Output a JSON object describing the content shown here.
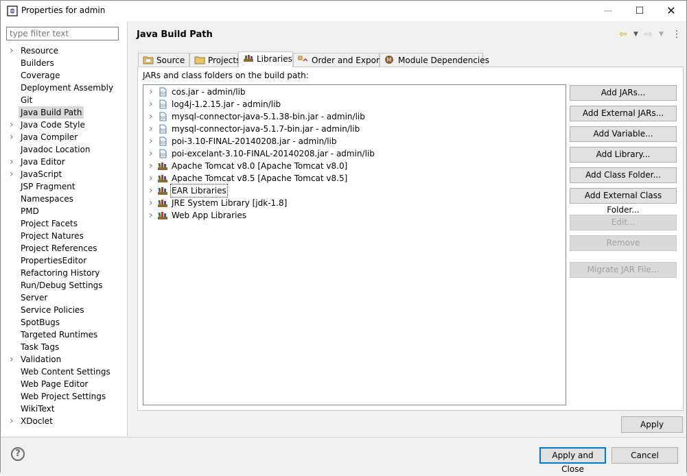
{
  "window": {
    "title": "Properties for admin",
    "minimize": "—",
    "maximize": "☐",
    "close": "✕"
  },
  "filter": {
    "placeholder": "type filter text",
    "value": ""
  },
  "nav": [
    {
      "label": "Resource",
      "expandable": true
    },
    {
      "label": "Builders",
      "expandable": false
    },
    {
      "label": "Coverage",
      "expandable": false
    },
    {
      "label": "Deployment Assembly",
      "expandable": false
    },
    {
      "label": "Git",
      "expandable": false
    },
    {
      "label": "Java Build Path",
      "expandable": false,
      "selected": true
    },
    {
      "label": "Java Code Style",
      "expandable": true
    },
    {
      "label": "Java Compiler",
      "expandable": true
    },
    {
      "label": "Javadoc Location",
      "expandable": false
    },
    {
      "label": "Java Editor",
      "expandable": true
    },
    {
      "label": "JavaScript",
      "expandable": true
    },
    {
      "label": "JSP Fragment",
      "expandable": false
    },
    {
      "label": "Namespaces",
      "expandable": false
    },
    {
      "label": "PMD",
      "expandable": false
    },
    {
      "label": "Project Facets",
      "expandable": false
    },
    {
      "label": "Project Natures",
      "expandable": false
    },
    {
      "label": "Project References",
      "expandable": false
    },
    {
      "label": "PropertiesEditor",
      "expandable": false
    },
    {
      "label": "Refactoring History",
      "expandable": false
    },
    {
      "label": "Run/Debug Settings",
      "expandable": false
    },
    {
      "label": "Server",
      "expandable": false
    },
    {
      "label": "Service Policies",
      "expandable": false
    },
    {
      "label": "SpotBugs",
      "expandable": false
    },
    {
      "label": "Targeted Runtimes",
      "expandable": false
    },
    {
      "label": "Task Tags",
      "expandable": false
    },
    {
      "label": "Validation",
      "expandable": true
    },
    {
      "label": "Web Content Settings",
      "expandable": false
    },
    {
      "label": "Web Page Editor",
      "expandable": false
    },
    {
      "label": "Web Project Settings",
      "expandable": false
    },
    {
      "label": "WikiText",
      "expandable": false
    },
    {
      "label": "XDoclet",
      "expandable": true
    }
  ],
  "page": {
    "title": "Java Build Path",
    "tabs": [
      {
        "label": "Source",
        "icon": "source-folder-icon"
      },
      {
        "label": "Projects",
        "icon": "projects-folder-icon"
      },
      {
        "label": "Libraries",
        "icon": "libraries-icon",
        "active": true
      },
      {
        "label": "Order and Export",
        "icon": "order-export-icon"
      },
      {
        "label": "Module Dependencies",
        "icon": "module-icon"
      }
    ],
    "libraries_label": "JARs and class folders on the build path:",
    "entries": [
      {
        "label": "cos.jar - admin/lib",
        "kind": "jar"
      },
      {
        "label": "log4j-1.2.15.jar - admin/lib",
        "kind": "jar"
      },
      {
        "label": "mysql-connector-java-5.1.38-bin.jar - admin/lib",
        "kind": "jar"
      },
      {
        "label": "mysql-connector-java-5.1.7-bin.jar - admin/lib",
        "kind": "jar"
      },
      {
        "label": "poi-3.10-FINAL-20140208.jar - admin/lib",
        "kind": "jar"
      },
      {
        "label": "poi-excelant-3.10-FINAL-20140208.jar - admin/lib",
        "kind": "jar"
      },
      {
        "label": "Apache Tomcat v8.0 [Apache Tomcat v8.0]",
        "kind": "library"
      },
      {
        "label": "Apache Tomcat v8.5 [Apache Tomcat v8.5]",
        "kind": "library"
      },
      {
        "label": "EAR Libraries",
        "kind": "library",
        "focused": true
      },
      {
        "label": "JRE System Library [jdk-1.8]",
        "kind": "library"
      },
      {
        "label": "Web App Libraries",
        "kind": "library"
      }
    ],
    "buttons": [
      {
        "label": "Add JARs...",
        "enabled": true
      },
      {
        "label": "Add External JARs...",
        "enabled": true
      },
      {
        "label": "Add Variable...",
        "enabled": true
      },
      {
        "label": "Add Library...",
        "enabled": true
      },
      {
        "label": "Add Class Folder...",
        "enabled": true
      },
      {
        "label": "Add External Class Folder...",
        "enabled": true
      },
      {
        "label": "Edit...",
        "enabled": false
      },
      {
        "label": "Remove",
        "enabled": false
      },
      {
        "label": "Migrate JAR File...",
        "enabled": false
      }
    ],
    "apply": "Apply"
  },
  "footer": {
    "help": "?",
    "apply_and_close": "Apply and Close",
    "cancel": "Cancel"
  },
  "colors": {
    "accent": "#0078d7",
    "selection": "#d9d9d9",
    "jar_icon": "#5a7fa8",
    "library_icon": "#8b6b2e"
  }
}
